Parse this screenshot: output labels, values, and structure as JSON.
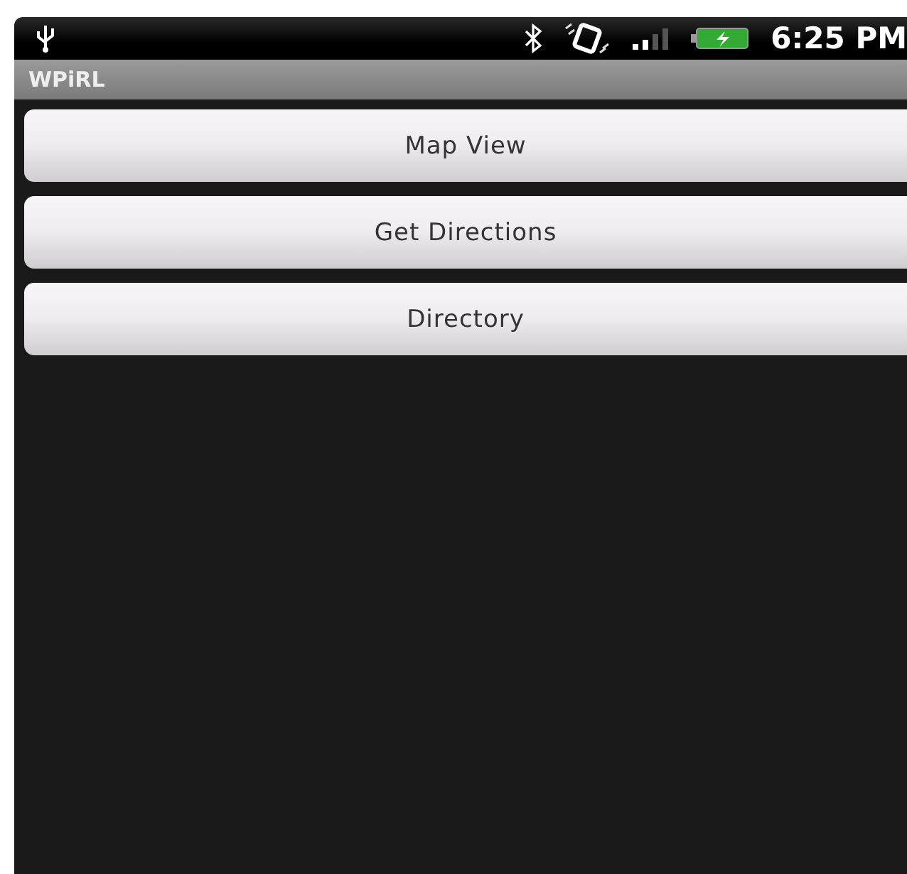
{
  "status_bar": {
    "time": "6:25 PM"
  },
  "title_bar": {
    "title": "WPiRL"
  },
  "buttons": [
    "Map View",
    "Get Directions",
    "Directory"
  ]
}
